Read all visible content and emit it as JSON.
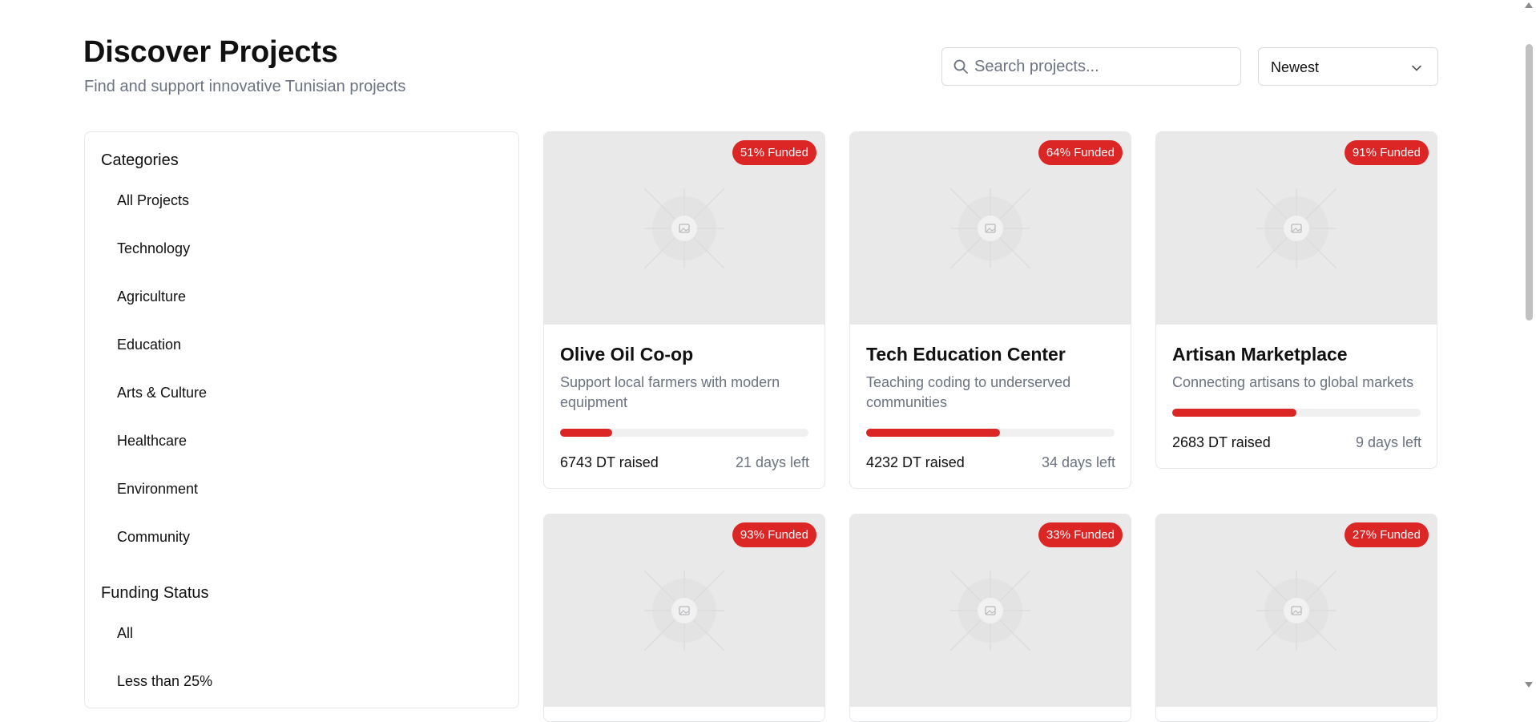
{
  "header": {
    "title": "Discover Projects",
    "subtitle": "Find and support innovative Tunisian projects"
  },
  "search": {
    "placeholder": "Search projects...",
    "value": ""
  },
  "sort": {
    "selected": "Newest"
  },
  "sidebar": {
    "categories_heading": "Categories",
    "categories": [
      "All Projects",
      "Technology",
      "Agriculture",
      "Education",
      "Arts & Culture",
      "Healthcare",
      "Environment",
      "Community"
    ],
    "funding_heading": "Funding Status",
    "funding": [
      "All",
      "Less than 25%"
    ]
  },
  "projects": [
    {
      "title": "Olive Oil Co-op",
      "description": "Support local farmers with modern equipment",
      "badge": "51% Funded",
      "progress": 0.21,
      "raised": "6743 DT raised",
      "days_left": "21 days left"
    },
    {
      "title": "Tech Education Center",
      "description": "Teaching coding to underserved communities",
      "badge": "64% Funded",
      "progress": 0.54,
      "raised": "4232 DT raised",
      "days_left": "34 days left"
    },
    {
      "title": "Artisan Marketplace",
      "description": "Connecting artisans to global markets",
      "badge": "91% Funded",
      "progress": 0.5,
      "raised": "2683 DT raised",
      "days_left": "9 days left"
    },
    {
      "badge": "93% Funded"
    },
    {
      "badge": "33% Funded"
    },
    {
      "badge": "27% Funded"
    }
  ],
  "colors": {
    "accent": "#dc2626",
    "muted_text": "#6b7280",
    "card_image_bg": "#e9e9ea"
  },
  "icons": {
    "search": "search-icon",
    "sort_chevron": "chevron-down-icon",
    "image_placeholder": "image-placeholder-icon"
  }
}
